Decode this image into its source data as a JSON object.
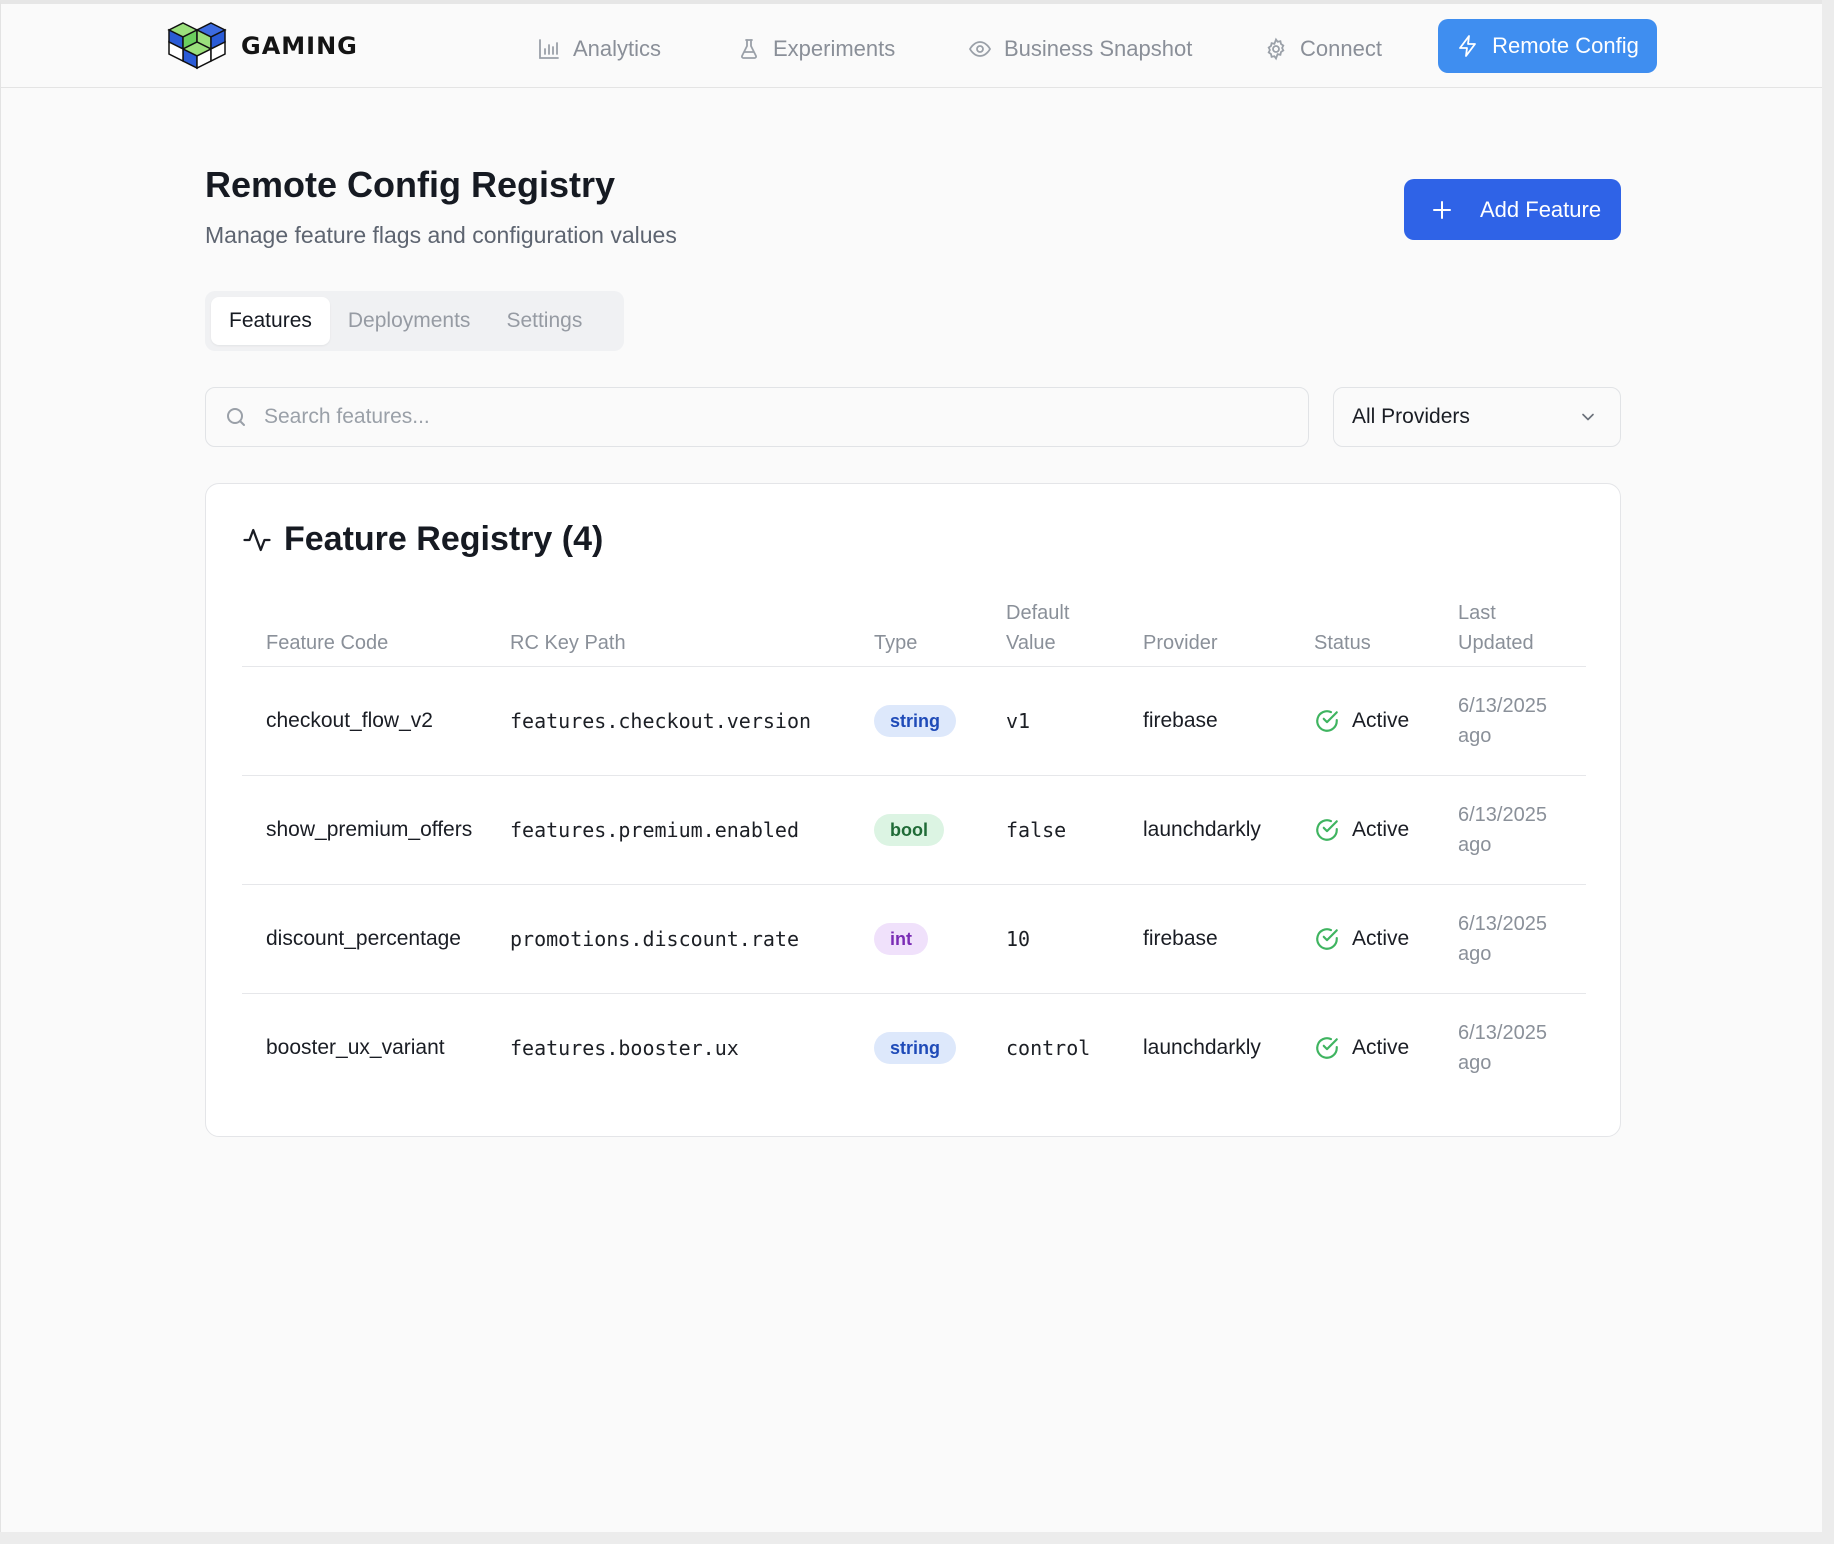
{
  "brand": {
    "name": "GAMING"
  },
  "nav": {
    "items": [
      {
        "label": "Analytics",
        "icon": "bar-chart-icon"
      },
      {
        "label": "Experiments",
        "icon": "flask-icon"
      },
      {
        "label": "Business Snapshot",
        "icon": "eye-icon"
      },
      {
        "label": "Connect",
        "icon": "gear-icon"
      }
    ],
    "active": {
      "label": "Remote Config",
      "icon": "lightning-icon"
    }
  },
  "page": {
    "title": "Remote Config Registry",
    "subtitle": "Manage feature flags and configuration values",
    "add_button": "Add Feature"
  },
  "tabs": [
    {
      "label": "Features",
      "active": true
    },
    {
      "label": "Deployments",
      "active": false
    },
    {
      "label": "Settings",
      "active": false
    }
  ],
  "search": {
    "placeholder": "Search features...",
    "value": ""
  },
  "filter": {
    "selected": "All Providers"
  },
  "registry": {
    "title": "Feature Registry (4)",
    "columns": {
      "feature_code": "Feature Code",
      "rc_key_path": "RC Key Path",
      "type": "Type",
      "default_value_1": "Default",
      "default_value_2": "Value",
      "provider": "Provider",
      "status": "Status",
      "last_updated_1": "Last",
      "last_updated_2": "Updated"
    },
    "rows": [
      {
        "code": "checkout_flow_v2",
        "path": "features.checkout.version",
        "type": "string",
        "default": "v1",
        "provider": "firebase",
        "status": "Active",
        "updated_1": "6/13/2025",
        "updated_2": "ago"
      },
      {
        "code": "show_premium_offers",
        "path": "features.premium.enabled",
        "type": "bool",
        "default": "false",
        "provider": "launchdarkly",
        "status": "Active",
        "updated_1": "6/13/2025",
        "updated_2": "ago"
      },
      {
        "code": "discount_percentage",
        "path": "promotions.discount.rate",
        "type": "int",
        "default": "10",
        "provider": "firebase",
        "status": "Active",
        "updated_1": "6/13/2025",
        "updated_2": "ago"
      },
      {
        "code": "booster_ux_variant",
        "path": "features.booster.ux",
        "type": "string",
        "default": "control",
        "provider": "launchdarkly",
        "status": "Active",
        "updated_1": "6/13/2025",
        "updated_2": "ago"
      }
    ]
  },
  "colors": {
    "accent": "#3f8ef0",
    "primary_button": "#2f63e7",
    "status_active": "#3fb460",
    "badge_string_bg": "#dde8fb",
    "badge_string_fg": "#1f4bb8",
    "badge_bool_bg": "#dcf4e3",
    "badge_bool_fg": "#1f6b37",
    "badge_int_bg": "#f0e1fb",
    "badge_int_fg": "#7a2cb5"
  }
}
